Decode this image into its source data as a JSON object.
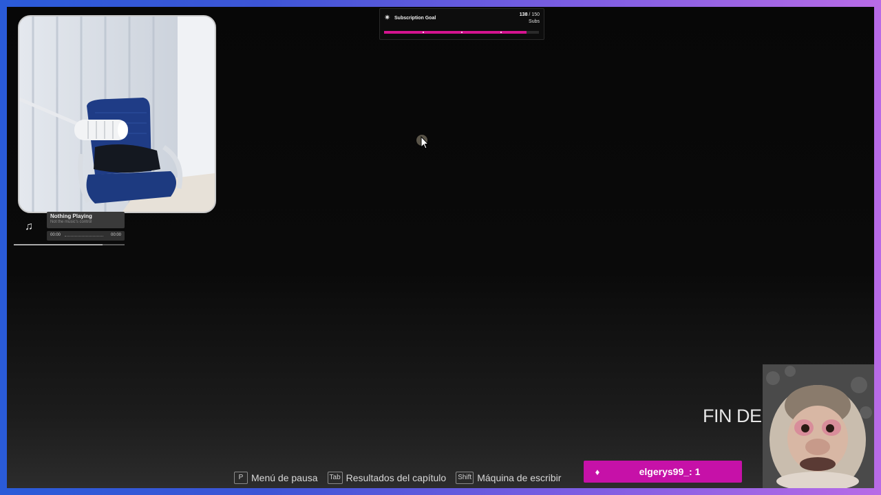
{
  "subscription_goal": {
    "title": "Subscription Goal",
    "current": "138",
    "separator": " / ",
    "target": "150",
    "unit": "Subs",
    "progress": 0.92,
    "accent_color": "#d4148f",
    "icon": "star-icon"
  },
  "now_playing": {
    "title": "Nothing Playing",
    "subtitle": "Not the music's control",
    "elapsed": "00:00",
    "total": "00:00",
    "icon": "music-note-icon",
    "progress": 0.8
  },
  "game_overlay": {
    "chapter_text": "FIN DEL",
    "hints": [
      {
        "key": "P",
        "label": "Menú de pausa"
      },
      {
        "key": "Tab",
        "label": "Resultados del capítulo"
      },
      {
        "key": "Shift",
        "label": "Máquina de escribir"
      }
    ]
  },
  "alert": {
    "text": "elgerys99_: 1",
    "icon": "diamond-icon",
    "color": "#c611a8"
  },
  "frame": {
    "gradient_start": "#2a5bd8",
    "gradient_end": "#b86be6"
  }
}
